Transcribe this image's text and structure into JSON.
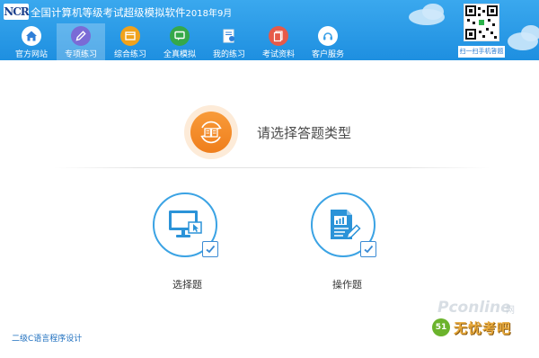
{
  "app": {
    "logo_text": "NCR",
    "title": "全国计算机等级考试超级模拟软件",
    "version": "2018年9月"
  },
  "nav": {
    "items": [
      {
        "label": "官方网站",
        "icon": "home-icon",
        "color": "#2f7fd8",
        "active": false
      },
      {
        "label": "专项练习",
        "icon": "pencil-icon",
        "color": "#7a6bd6",
        "active": true
      },
      {
        "label": "综合练习",
        "icon": "window-icon",
        "color": "#f0a21c",
        "active": false
      },
      {
        "label": "全真模拟",
        "icon": "chat-screen-icon",
        "color": "#35a84a",
        "active": false
      },
      {
        "label": "我的练习",
        "icon": "document-person-icon",
        "color": "#ffffff",
        "active": false
      },
      {
        "label": "考试资料",
        "icon": "files-icon",
        "color": "#e65a4a",
        "active": false
      },
      {
        "label": "客户服务",
        "icon": "headset-icon",
        "color": "#3aa0e8",
        "active": false
      }
    ]
  },
  "qr": {
    "caption": "扫一扫手机答题"
  },
  "main": {
    "prompt": "请选择答题类型",
    "choices": [
      {
        "label": "选择题",
        "icon": "monitor-cursor-icon"
      },
      {
        "label": "操作题",
        "icon": "document-chart-icon"
      }
    ]
  },
  "footer": {
    "subject": "二级C语言程序设计"
  },
  "watermark": {
    "brand": "Pconline",
    "net": "网",
    "sub": "无忧考吧"
  },
  "colors": {
    "header": "#1e8fe0",
    "accent": "#3ba3e4",
    "orange": "#ef7e1c"
  }
}
